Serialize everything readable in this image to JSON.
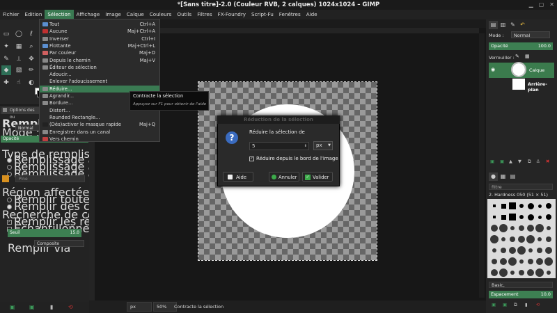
{
  "window": {
    "title": "*[Sans titre]-2.0 (Couleur RVB, 2 calques) 1024x1024 – GIMP",
    "controls": [
      "minimize-icon",
      "maximize-icon",
      "close-icon"
    ]
  },
  "menubar": [
    "Fichier",
    "Edition",
    "Sélection",
    "Affichage",
    "Image",
    "Calque",
    "Couleurs",
    "Outils",
    "Filtres",
    "FX-Foundry",
    "Script-Fu",
    "Fenêtres",
    "Aide"
  ],
  "menubar_active_index": 2,
  "selection_menu": [
    {
      "label": "Tout",
      "shortcut": "Ctrl+A",
      "icon": "select-all-icon"
    },
    {
      "label": "Aucune",
      "shortcut": "Maj+Ctrl+A",
      "icon": "select-none-icon"
    },
    {
      "label": "Inverser",
      "shortcut": "Ctrl+I",
      "icon": "invert-icon"
    },
    {
      "label": "Flottante",
      "shortcut": "Maj+Ctrl+L",
      "icon": "float-icon"
    },
    {
      "label": "Par couleur",
      "shortcut": "Maj+O",
      "icon": "by-color-icon"
    },
    {
      "label": "Depuis le chemin",
      "shortcut": "Maj+V",
      "icon": "from-path-icon"
    },
    {
      "label": "Éditeur de sélection",
      "shortcut": "",
      "icon": "selection-editor-icon"
    },
    {
      "label": "Adoucir...",
      "shortcut": "",
      "icon": ""
    },
    {
      "label": "Enlever l'adoucissement",
      "shortcut": "",
      "icon": ""
    },
    {
      "label": "Réduire...",
      "shortcut": "",
      "icon": "shrink-icon"
    },
    {
      "label": "Agrandir...",
      "shortcut": "",
      "icon": "grow-icon"
    },
    {
      "label": "Bordure...",
      "shortcut": "",
      "icon": "border-icon"
    },
    {
      "label": "Distort...",
      "shortcut": "",
      "icon": ""
    },
    {
      "label": "Rounded Rectangle...",
      "shortcut": "",
      "icon": ""
    },
    {
      "label": "(Dés)activer le masque rapide",
      "shortcut": "Maj+Q",
      "icon": "quickmask-icon"
    },
    {
      "label": "Enregistrer dans un canal",
      "shortcut": "",
      "icon": "channel-icon"
    },
    {
      "label": "Vers chemin",
      "shortcut": "",
      "icon": "to-path-icon"
    }
  ],
  "selection_menu_highlight_index": 9,
  "tooltip": {
    "title": "Contracte la sélection",
    "hint": "Appuyez sur F1 pour obtenir de l'aide"
  },
  "tool_options": {
    "tab_label": "Options des ou",
    "title": "Remplissage",
    "mode_label": "Mode :",
    "mode_value": "Normal",
    "opacity_label": "Opacité",
    "fill_type_heading": "Type de remplissage (Ctrl)",
    "fill_types": [
      "Remplissage avec la couleur de PP",
      "Remplissage avec la couleur d'AP",
      "Remplissage avec le motif"
    ],
    "fill_type_selected": 0,
    "pattern_name": "Pine",
    "affected_heading": "Région affectée (Maj)",
    "affected": [
      "Remplir toute la sélection",
      "Remplir des couleurs similaires"
    ],
    "affected_selected": 1,
    "similar_heading": "Recherche de couleurs similaires",
    "similar_checks": [
      "Remplir les régions transparentes",
      "Échantillonner sur tous les calques"
    ],
    "similar_checked": [
      true,
      false
    ],
    "threshold_label": "Seuil",
    "threshold_value": "15.0",
    "fill_via_label": "Remplir via",
    "fill_via_value": "Composite"
  },
  "dialog": {
    "title": "Réduction de la sélection",
    "prompt": "Réduire la sélection de",
    "value": "5",
    "unit": "px",
    "checkbox_label": "Réduire depuis le bord de l'image",
    "checkbox_checked": true,
    "help": "Aide",
    "cancel": "Annuler",
    "ok": "Valider"
  },
  "statusbar": {
    "unit": "px",
    "zoom": "50%",
    "message": "Contracte la sélection"
  },
  "layers": {
    "mode_label": "Mode :",
    "mode_value": "Normal",
    "opacity_label": "Opacité",
    "opacity_value": "100.0",
    "lock_label": "Verrouiller :",
    "items": [
      {
        "name": "Calque",
        "active": true
      },
      {
        "name": "Arrière-plan",
        "active": false
      }
    ]
  },
  "brushes": {
    "filter_label": "filtre",
    "current": "2. Hardness 050 (51 × 51)",
    "tag": "Basic,",
    "spacing_label": "Espacement",
    "spacing_value": "10.0"
  }
}
